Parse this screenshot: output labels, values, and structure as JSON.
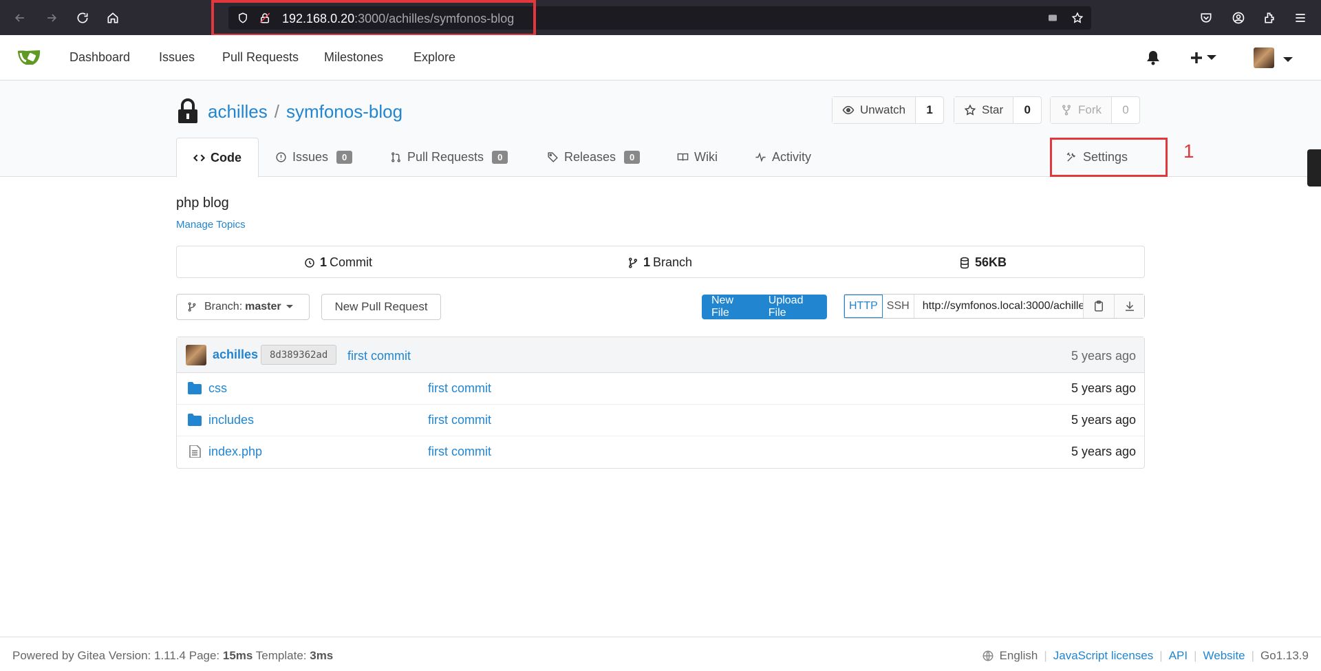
{
  "browser": {
    "url_host": "192.168.0.20",
    "url_path": ":3000/achilles/symfonos-blog"
  },
  "nav": {
    "items": [
      "Dashboard",
      "Issues",
      "Pull Requests",
      "Milestones",
      "Explore"
    ]
  },
  "repo": {
    "owner": "achilles",
    "separator": "/",
    "name": "symfonos-blog",
    "description": "php blog",
    "manage_topics": "Manage Topics",
    "watch": {
      "label": "Unwatch",
      "count": "1"
    },
    "star": {
      "label": "Star",
      "count": "0"
    },
    "fork": {
      "label": "Fork",
      "count": "0"
    }
  },
  "tabs": [
    {
      "label": "Code",
      "badge": null
    },
    {
      "label": "Issues",
      "badge": "0"
    },
    {
      "label": "Pull Requests",
      "badge": "0"
    },
    {
      "label": "Releases",
      "badge": "0"
    },
    {
      "label": "Wiki",
      "badge": null
    },
    {
      "label": "Activity",
      "badge": null
    },
    {
      "label": "Settings",
      "badge": null
    }
  ],
  "annotation": {
    "number": "1"
  },
  "stats": {
    "commits_count": "1",
    "commits_label": "Commit",
    "branches_count": "1",
    "branches_label": "Branch",
    "size": "56KB"
  },
  "toolbar": {
    "branch_prefix": "Branch:",
    "branch_name": "master",
    "new_pull_request": "New Pull Request",
    "new_file": "New File",
    "upload_file": "Upload File",
    "http": "HTTP",
    "ssh": "SSH",
    "clone_url": "http://symfonos.local:3000/achille"
  },
  "latest_commit": {
    "author": "achilles",
    "sha": "8d389362ad",
    "message": "first commit",
    "time": "5 years ago"
  },
  "files": [
    {
      "name": "css",
      "type": "folder",
      "message": "first commit",
      "time": "5 years ago"
    },
    {
      "name": "includes",
      "type": "folder",
      "message": "first commit",
      "time": "5 years ago"
    },
    {
      "name": "index.php",
      "type": "file",
      "message": "first commit",
      "time": "5 years ago"
    }
  ],
  "footer": {
    "powered_by": "Powered by Gitea Version: 1.11.4 Page:",
    "page_time": "15ms",
    "template_label": "Template:",
    "template_time": "3ms",
    "language": "English",
    "links": [
      "JavaScript licenses",
      "API",
      "Website"
    ],
    "go_version": "Go1.13.9"
  },
  "colors": {
    "accent": "#2185d0",
    "annotation": "#e0383d"
  }
}
